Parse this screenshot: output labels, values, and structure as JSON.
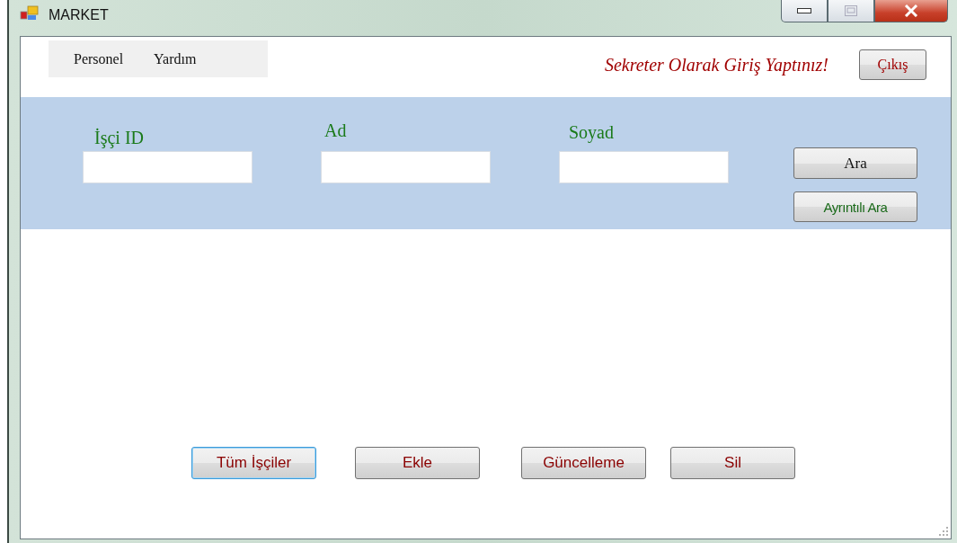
{
  "window": {
    "title": "MARKET"
  },
  "menu": [
    {
      "label": "Personel"
    },
    {
      "label": "Yardım"
    }
  ],
  "login_message": "Sekreter Olarak Giriş Yaptınız!",
  "exit_button": "Çıkış",
  "search_fields": [
    {
      "label": "İşçi ID"
    },
    {
      "label": "Ad"
    },
    {
      "label": "Soyad"
    }
  ],
  "search_button": "Ara",
  "detail_search_button": "Ayrıntılı Ara",
  "actions": [
    {
      "label": "Tüm İşçiler",
      "focused": true
    },
    {
      "label": "Ekle",
      "focused": false
    },
    {
      "label": "Güncelleme",
      "focused": false
    },
    {
      "label": "Sil",
      "focused": false
    }
  ]
}
